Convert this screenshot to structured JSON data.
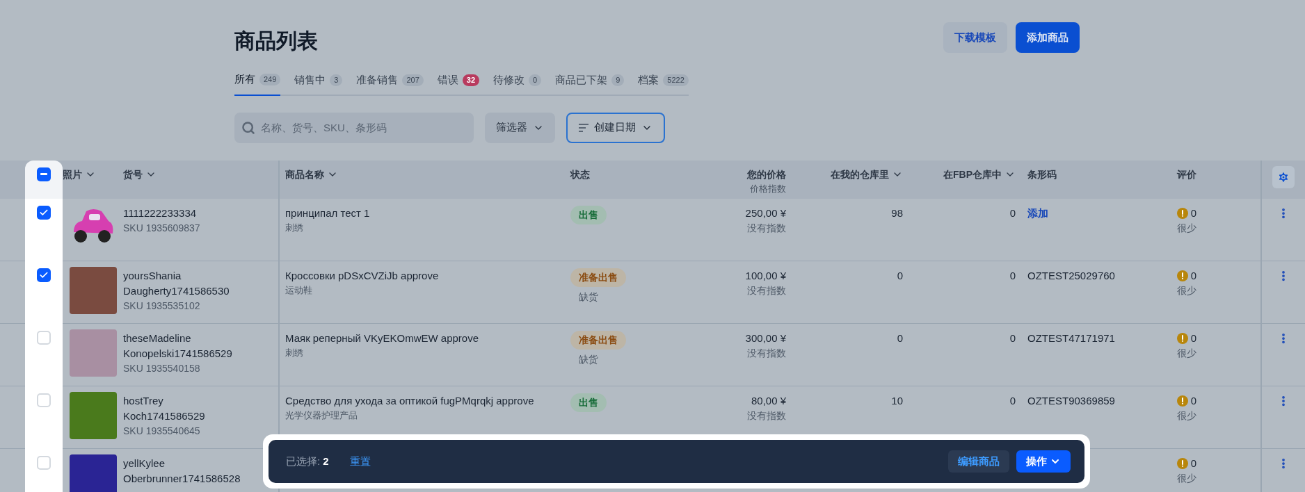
{
  "page": {
    "title": "商品列表"
  },
  "header_buttons": [
    {
      "label": "下载模板",
      "kind": "secondary"
    },
    {
      "label": "添加商品",
      "kind": "primary"
    }
  ],
  "tabs": [
    {
      "label": "所有",
      "count": "249",
      "selected": true,
      "alert": false
    },
    {
      "label": "销售中",
      "count": "3",
      "selected": false,
      "alert": false
    },
    {
      "label": "准备销售",
      "count": "207",
      "selected": false,
      "alert": false
    },
    {
      "label": "错误",
      "count": "32",
      "selected": false,
      "alert": true
    },
    {
      "label": "待修改",
      "count": "0",
      "selected": false,
      "alert": false
    },
    {
      "label": "商品已下架",
      "count": "9",
      "selected": false,
      "alert": false
    },
    {
      "label": "档案",
      "count": "5222",
      "selected": false,
      "alert": false
    }
  ],
  "search": {
    "placeholder": "名称、货号、SKU、条形码"
  },
  "filter_button": "筛选器",
  "sort_button": "创建日期",
  "table": {
    "select_all": {
      "partial": true
    },
    "columns": [
      {
        "label": "照片",
        "sortable": true
      },
      {
        "label": "货号",
        "sortable": true
      },
      {
        "label": "商品名称",
        "sortable": true
      },
      {
        "label": "状态",
        "sortable": false
      },
      {
        "label": "您的价格",
        "sublabel": "价格指数",
        "sortable": false
      },
      {
        "label": "在我的仓库里",
        "sortable": true
      },
      {
        "label": "在FBP仓库中",
        "sortable": true
      },
      {
        "label": "条形码",
        "sortable": false
      },
      {
        "label": "评价",
        "sortable": false
      }
    ],
    "rows": [
      {
        "selected": true,
        "photo": {
          "kind": "car",
          "color": "#d63fb0"
        },
        "article": [
          "1111222233334"
        ],
        "sku": "SKU 1935609837",
        "name": "принципал тест 1",
        "category": "刺绣",
        "status": {
          "label": "出售",
          "kind": "success"
        },
        "price": "250,00 ¥",
        "price_index": "没有指数",
        "my_stock": "98",
        "fbp_stock": "0",
        "barcode": {
          "text": "添加",
          "link": true
        },
        "rating": "0",
        "rating_label": "很少"
      },
      {
        "selected": true,
        "photo": {
          "kind": "swatch",
          "color": "#7a4b40"
        },
        "article": [
          "yoursShania",
          "Daugherty1741586530"
        ],
        "sku": "SKU 1935535102",
        "name": "Кроссовки pDSxCVZiJb approve",
        "category": "运动鞋",
        "status": {
          "label": "准备出售",
          "kind": "warning",
          "note": "缺货"
        },
        "price": "100,00 ¥",
        "price_index": "没有指数",
        "my_stock": "0",
        "fbp_stock": "0",
        "barcode": {
          "text": "OZTEST25029760",
          "link": false
        },
        "rating": "0",
        "rating_label": "很少"
      },
      {
        "selected": false,
        "photo": {
          "kind": "swatch",
          "color": "#a88fa2"
        },
        "article": [
          "theseMadeline",
          "Konopelski1741586529"
        ],
        "sku": "SKU 1935540158",
        "name": "Маяк реперный VKyEKOmwEW approve",
        "category": "刺绣",
        "status": {
          "label": "准备出售",
          "kind": "warning",
          "note": "缺货"
        },
        "price": "300,00 ¥",
        "price_index": "没有指数",
        "my_stock": "0",
        "fbp_stock": "0",
        "barcode": {
          "text": "OZTEST47171971",
          "link": false
        },
        "rating": "0",
        "rating_label": "很少"
      },
      {
        "selected": false,
        "photo": {
          "kind": "swatch",
          "color": "#4a7a1c"
        },
        "article": [
          "hostTrey",
          "Koch1741586529"
        ],
        "sku": "SKU 1935540645",
        "name": "Средство для ухода за оптикой fugPMqrqkj approve",
        "category": "光学仪器护理产品",
        "status": {
          "label": "出售",
          "kind": "success"
        },
        "price": "80,00 ¥",
        "price_index": "没有指数",
        "my_stock": "10",
        "fbp_stock": "0",
        "barcode": {
          "text": "OZTEST90369859",
          "link": false
        },
        "rating": "0",
        "rating_label": "很少"
      },
      {
        "selected": false,
        "photo": {
          "kind": "swatch",
          "color": "#2a2494"
        },
        "article": [
          "yellKylee",
          "Oberbrunner1741586528"
        ],
        "rating": "0",
        "rating_label": "很少"
      }
    ]
  },
  "selection_bar": {
    "label": "已选择:",
    "count": "2",
    "reset": "重置",
    "buttons": [
      {
        "label": "编辑商品",
        "kind": "secondary"
      },
      {
        "label": "操作",
        "kind": "menu"
      }
    ]
  }
}
